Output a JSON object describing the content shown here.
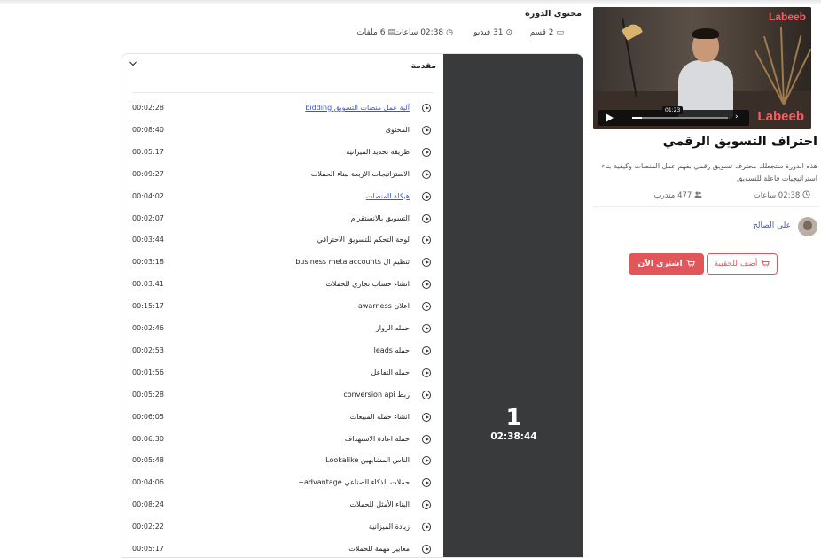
{
  "video": {
    "brand_top": "Labeeb",
    "brand_bottom": "Labeeb",
    "time_tip": "01:23",
    "progress": 0.1
  },
  "course": {
    "title": "احتراف التسويق الرقمي",
    "description": "هذه الدورة ستجعلك محترف تسويق رقمي بفهم عمل المنصات وكيفية بناء استراتيجيات فاعلة للتسويق",
    "duration": "02:38 ساعات",
    "trainees": "477 متدرب",
    "instructor": "علي الصالح",
    "buy_label": "اشتري الآن",
    "cart_label": "أضف للحقيبة"
  },
  "content": {
    "heading": "محتوى الدورة",
    "meta": {
      "sections": "2 قسم",
      "videos": "31 فيديو",
      "hours": "02:38 ساعات",
      "files": "6 ملفات"
    },
    "section": {
      "title": "مقدمة",
      "number": "1",
      "total_time": "02:38:44"
    },
    "lessons": [
      {
        "title": "آلية عمل منصات التسويق bidding",
        "time": "00:02:28",
        "link": true
      },
      {
        "title": "المحتوى",
        "time": "00:08:40",
        "link": false
      },
      {
        "title": "طريقة تحديد الميزانية",
        "time": "00:05:17",
        "link": false
      },
      {
        "title": "الاستراتيجات الاربعة لبناء الحملات",
        "time": "00:09:27",
        "link": false
      },
      {
        "title": "هيكلة المنصات",
        "time": "00:04:02",
        "link": true
      },
      {
        "title": "التسويق بالانستقرام",
        "time": "00:02:07",
        "link": false
      },
      {
        "title": "لوحة التحكم للتسويق الاحترافي",
        "time": "00:03:44",
        "link": false
      },
      {
        "title": "تنظيم ال business meta accounts",
        "time": "00:03:18",
        "link": false
      },
      {
        "title": "انشاء حساب تجاري للحملات",
        "time": "00:03:41",
        "link": false
      },
      {
        "title": "اعلان awarness",
        "time": "00:15:17",
        "link": false
      },
      {
        "title": "حمله الزوار",
        "time": "00:02:46",
        "link": false
      },
      {
        "title": "حمله leads",
        "time": "00:02:53",
        "link": false
      },
      {
        "title": "حمله التفاعل",
        "time": "00:01:56",
        "link": false
      },
      {
        "title": "ربط conversion api",
        "time": "00:05:28",
        "link": false
      },
      {
        "title": "انشاء حمله المبيعات",
        "time": "00:06:05",
        "link": false
      },
      {
        "title": "حملة اعادة الاستهداف",
        "time": "00:06:30",
        "link": false
      },
      {
        "title": "الناس المشابهين Lookalike",
        "time": "00:05:48",
        "link": false
      },
      {
        "title": "حملات الذكاء الصناعي advantage+",
        "time": "00:04:06",
        "link": false
      },
      {
        "title": "البناء الأمثل للحملات",
        "time": "00:08:24",
        "link": false
      },
      {
        "title": "زيادة الميزانية",
        "time": "00:02:22",
        "link": false
      },
      {
        "title": "معايير مهمة للحملات",
        "time": "00:05:17",
        "link": false
      }
    ]
  },
  "colors": {
    "accent": "#e05659",
    "link": "#3b57c4",
    "dark_panel": "#393a3c"
  }
}
